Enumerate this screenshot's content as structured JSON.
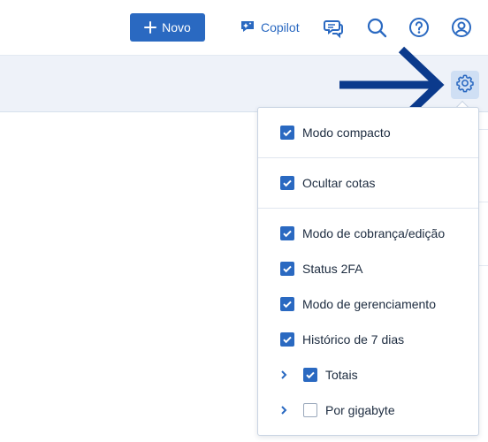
{
  "header": {
    "new_button_label": "Novo",
    "copilot_label": "Copilot",
    "icons": [
      "plus-icon",
      "copilot-icon",
      "chat-icon",
      "search-icon",
      "help-icon",
      "user-icon"
    ]
  },
  "toolbar": {
    "settings_icon": "gear-icon",
    "pointer": "arrow-right-icon"
  },
  "column_menu": {
    "items": [
      {
        "label": "Modo compacto",
        "checked": true
      },
      {
        "label": "Ocultar cotas",
        "checked": true
      },
      {
        "label": "Modo de cobrança/edição",
        "checked": true
      },
      {
        "label": "Status 2FA",
        "checked": true
      },
      {
        "label": "Modo de gerenciamento",
        "checked": true
      },
      {
        "label": "Histórico de 7 dias",
        "checked": true
      },
      {
        "label": "Totais",
        "checked": true,
        "expandable": true
      },
      {
        "label": "Por gigabyte",
        "checked": false,
        "expandable": true
      }
    ]
  },
  "colors": {
    "accent": "#2a69c1",
    "arrow": "#0b3a8c",
    "toolbar_bg": "#eef2f9"
  }
}
